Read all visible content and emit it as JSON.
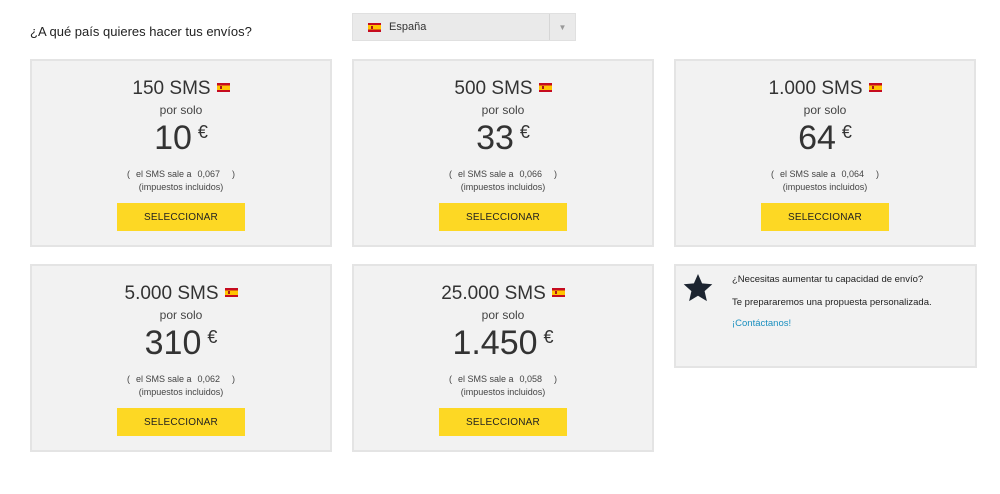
{
  "header": {
    "question": "¿A qué país quieres hacer tus envíos?",
    "country_selected": "España",
    "dropdown_arrow": "▼"
  },
  "plans": [
    {
      "qty": "150 SMS",
      "por": "por solo",
      "price": "10",
      "currency": "€",
      "unit_label": "el SMS sale a",
      "unit_price": "0,067",
      "paren_open": "(",
      "paren_close": ")",
      "tax": "(impuestos incluidos)",
      "button": "SELECCIONAR"
    },
    {
      "qty": "500 SMS",
      "por": "por solo",
      "price": "33",
      "currency": "€",
      "unit_label": "el SMS sale a",
      "unit_price": "0,066",
      "paren_open": "(",
      "paren_close": ")",
      "tax": "(impuestos incluidos)",
      "button": "SELECCIONAR"
    },
    {
      "qty": "1.000 SMS",
      "por": "por solo",
      "price": "64",
      "currency": "€",
      "unit_label": "el SMS sale a",
      "unit_price": "0,064",
      "paren_open": "(",
      "paren_close": ")",
      "tax": "(impuestos incluidos)",
      "button": "SELECCIONAR"
    },
    {
      "qty": "5.000 SMS",
      "por": "por solo",
      "price": "310",
      "currency": "€",
      "unit_label": "el SMS sale a",
      "unit_price": "0,062",
      "paren_open": "(",
      "paren_close": ")",
      "tax": "(impuestos incluidos)",
      "button": "SELECCIONAR"
    },
    {
      "qty": "25.000 SMS",
      "por": "por solo",
      "price": "1.450",
      "currency": "€",
      "unit_label": "el SMS sale a",
      "unit_price": "0,058",
      "paren_open": "(",
      "paren_close": ")",
      "tax": "(impuestos incluidos)",
      "button": "SELECCIONAR"
    }
  ],
  "custom": {
    "icon": "star-icon",
    "line1": "¿Necesitas aumentar tu capacidad de envío?",
    "line2": "Te prepararemos una propuesta personalizada.",
    "link": "¡Contáctanos!",
    "link_color": "#1a8fbf"
  },
  "colors": {
    "button_bg": "#fdd824",
    "card_bg": "#f2f2f2",
    "card_border": "#e4e4e4"
  }
}
